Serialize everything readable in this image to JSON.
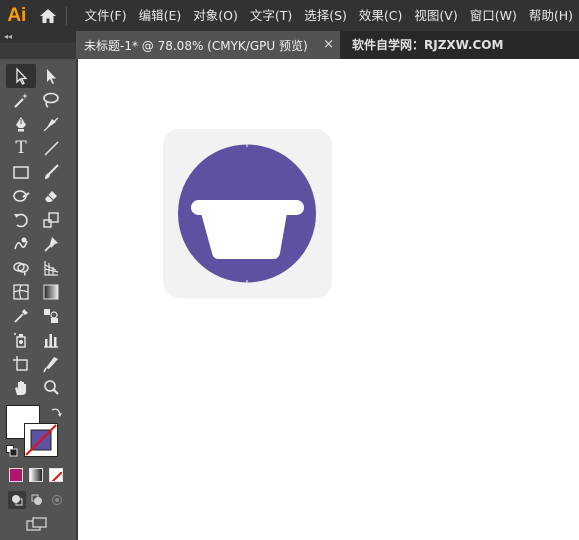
{
  "app": {
    "logo": "Ai"
  },
  "menu": [
    "文件(F)",
    "编辑(E)",
    "对象(O)",
    "文字(T)",
    "选择(S)",
    "效果(C)",
    "视图(V)",
    "窗口(W)",
    "帮助(H)"
  ],
  "tabs": {
    "document": "未标题-1* @ 78.08% (CMYK/GPU 预览)",
    "close": "×",
    "site": "软件自学网：RJZXW.COM"
  },
  "panel": {
    "collapse": "◂◂"
  },
  "tools": [
    [
      "selection-tool-icon",
      "direct-selection-tool-icon"
    ],
    [
      "magic-wand-tool-icon",
      "lasso-tool-icon"
    ],
    [
      "pen-tool-icon",
      "curvature-tool-icon"
    ],
    [
      "type-tool-icon",
      "line-segment-tool-icon"
    ],
    [
      "rectangle-tool-icon",
      "paintbrush-tool-icon"
    ],
    [
      "shaper-tool-icon",
      "eraser-tool-icon"
    ],
    [
      "rotate-tool-icon",
      "scale-tool-icon"
    ],
    [
      "warp-tool-icon",
      "puppet-warp-tool-icon"
    ],
    [
      "shape-builder-tool-icon",
      "perspective-grid-tool-icon"
    ],
    [
      "mesh-tool-icon",
      "gradient-tool-icon"
    ],
    [
      "eyedropper-tool-icon",
      "blend-tool-icon"
    ],
    [
      "symbol-sprayer-tool-icon",
      "column-graph-tool-icon"
    ],
    [
      "artboard-tool-icon",
      "slice-tool-icon"
    ],
    [
      "hand-tool-icon",
      "zoom-tool-icon"
    ]
  ],
  "type_tool_glyph": "T",
  "colors": {
    "menubar": "#323232",
    "panel": "#535353",
    "canvas": "#ffffff",
    "icon_bg": "#f2f2f2",
    "icon_circle": "#5d51a1",
    "logo": "#ff9a00",
    "stroke_swatch_fill": "#5d51a1"
  }
}
